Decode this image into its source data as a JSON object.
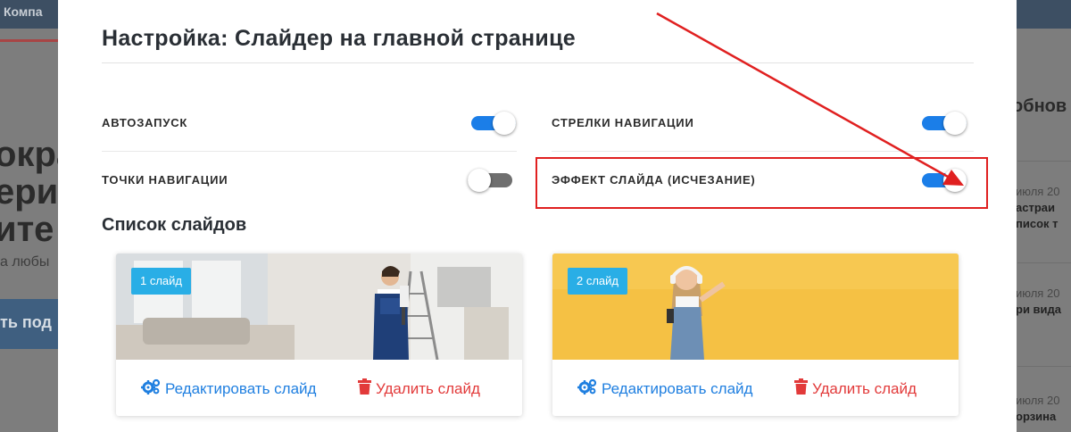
{
  "background_page": {
    "top_bar_text": "Компа",
    "left_text_lines": [
      "окра",
      "ериа",
      "ите"
    ],
    "left_small_text": "а любы",
    "left_button_label": "ть под",
    "right_heading": "обнов",
    "right_items": [
      {
        "date": "июля 20",
        "title_lines": [
          "астраи",
          "писок т"
        ]
      },
      {
        "date": "июля 20",
        "title_lines": [
          "ри вида"
        ]
      },
      {
        "date": "июля 20",
        "title_lines": [
          "орзина"
        ]
      }
    ]
  },
  "modal": {
    "title": "Настройка: Слайдер на главной странице",
    "settings": [
      {
        "label": "АВТОЗАПУСК",
        "enabled": true
      },
      {
        "label": "СТРЕЛКИ НАВИГАЦИИ",
        "enabled": true
      },
      {
        "label": "ТОЧКИ НАВИГАЦИИ",
        "enabled": false
      },
      {
        "label": "ЭФФЕКТ СЛАЙДА (ИСЧЕЗАНИЕ)",
        "enabled": true
      }
    ],
    "slides_section_title": "Список слайдов",
    "slides": [
      {
        "badge": "1 слайд",
        "edit_label": "Редактировать слайд",
        "delete_label": "Удалить слайд"
      },
      {
        "badge": "2 слайд",
        "edit_label": "Редактировать слайд",
        "delete_label": "Удалить слайд"
      }
    ]
  },
  "colors": {
    "toggle_on": "#1b7ee8",
    "toggle_off": "#6f6f6f",
    "badge": "#29aee6",
    "edit_link": "#1f7fe0",
    "delete_link": "#e23a3a",
    "annotation": "#e02020"
  },
  "icons": {
    "edit": "gears-icon",
    "delete": "trash-icon"
  }
}
